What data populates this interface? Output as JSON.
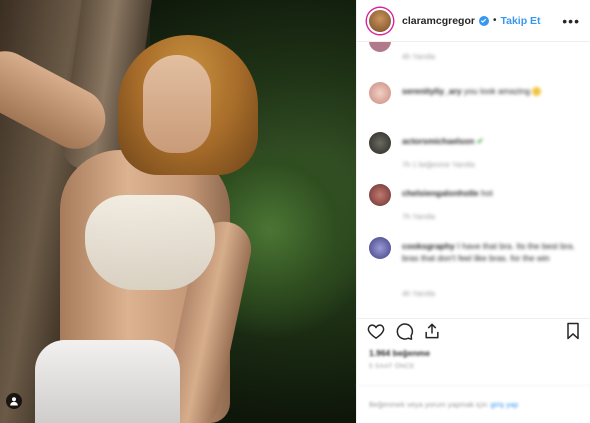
{
  "post": {
    "username": "claramcgregor",
    "separator": "•",
    "follow_label": "Takip Et",
    "more_label": "•••"
  },
  "comments": [
    {
      "author": "",
      "text": "",
      "meta": "4h   Yanıtla",
      "avatar_color": "#b07a8a"
    },
    {
      "author": "serenityliy_ary",
      "text": "you look amazing",
      "meta": "",
      "avatar_color": "#d9a39a",
      "emoji": "face"
    },
    {
      "author": "actorsmichaelson",
      "text": "",
      "meta": "7h   1 beğenme   Yanıtla",
      "avatar_color": "#3b3b36",
      "badge": "check"
    },
    {
      "author": "chelsiengalonhstle",
      "text": "hot",
      "meta": "7h   Yanıtla",
      "avatar_color": "#8a4a4a"
    },
    {
      "author": "cooksgraphy",
      "text": "I have that bra. Its the best bra. bras that don't feel like bras. for the win",
      "meta": "4h   Yanıtla",
      "avatar_color": "#5a5aa0"
    }
  ],
  "likes_text": "1.964 beğenme",
  "time_text": "5 SAAT ÖNCE",
  "login": {
    "text": "Beğenmek veya yorum yapmak için",
    "link": "giriş yap"
  },
  "colors": {
    "accent": "#3897f0",
    "text": "#262626",
    "muted": "#999999",
    "border": "#efefef"
  },
  "icons": [
    "user-tag-icon",
    "verified-badge-icon",
    "more-options-icon",
    "heart-icon",
    "comment-icon",
    "share-icon",
    "bookmark-icon"
  ]
}
